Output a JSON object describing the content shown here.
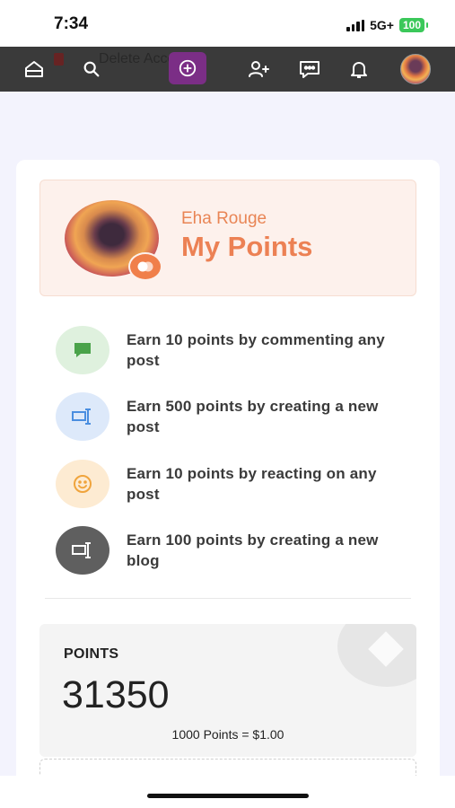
{
  "status": {
    "time": "7:34",
    "network": "5G+",
    "battery": "100"
  },
  "nav": {
    "ghost_text": "Delete Account",
    "icons": [
      "home-icon",
      "search-icon",
      "add-circle-icon",
      "add-user-icon",
      "message-icon",
      "bell-icon",
      "avatar"
    ]
  },
  "profile": {
    "name": "Eha Rouge",
    "title": "My Points"
  },
  "earn_items": [
    {
      "text": "Earn 10 points by commenting any post",
      "icon": "comment-icon",
      "color": "#dff1de"
    },
    {
      "text": "Earn 500 points by creating a new post",
      "icon": "post-icon",
      "color": "#dde9fa"
    },
    {
      "text": "Earn 10 points by reacting on any post",
      "icon": "smiley-icon",
      "color": "#fdebd2"
    },
    {
      "text": "Earn 100 points by creating a new blog",
      "icon": "blog-icon",
      "color": "#5f5f5f"
    }
  ],
  "points": {
    "label": "POINTS",
    "value": "31350",
    "rate": "1000 Points = $1.00"
  },
  "colors": {
    "accent": "#ec8154",
    "nav_bg": "#3a3a3a",
    "add_button": "#7b2e86"
  }
}
